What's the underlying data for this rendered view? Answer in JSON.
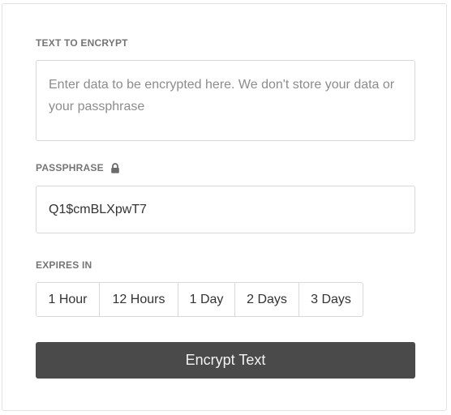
{
  "form": {
    "text_label": "TEXT TO ENCRYPT",
    "text_placeholder": "Enter data to be encrypted here. We don't store your data or your passphrase",
    "text_value": "",
    "passphrase_label": "PASSPHRASE",
    "passphrase_icon": "lock-icon",
    "passphrase_value": "Q1$cmBLXpwT7",
    "expires_label": "EXPIRES IN",
    "expiry_options": [
      {
        "label": "1 Hour"
      },
      {
        "label": "12 Hours"
      },
      {
        "label": "1 Day"
      },
      {
        "label": "2 Days"
      },
      {
        "label": "3 Days"
      }
    ],
    "submit_label": "Encrypt Text"
  },
  "colors": {
    "button_background": "#4a4a4a",
    "label_text": "#757575",
    "border": "#d9d9d9"
  }
}
